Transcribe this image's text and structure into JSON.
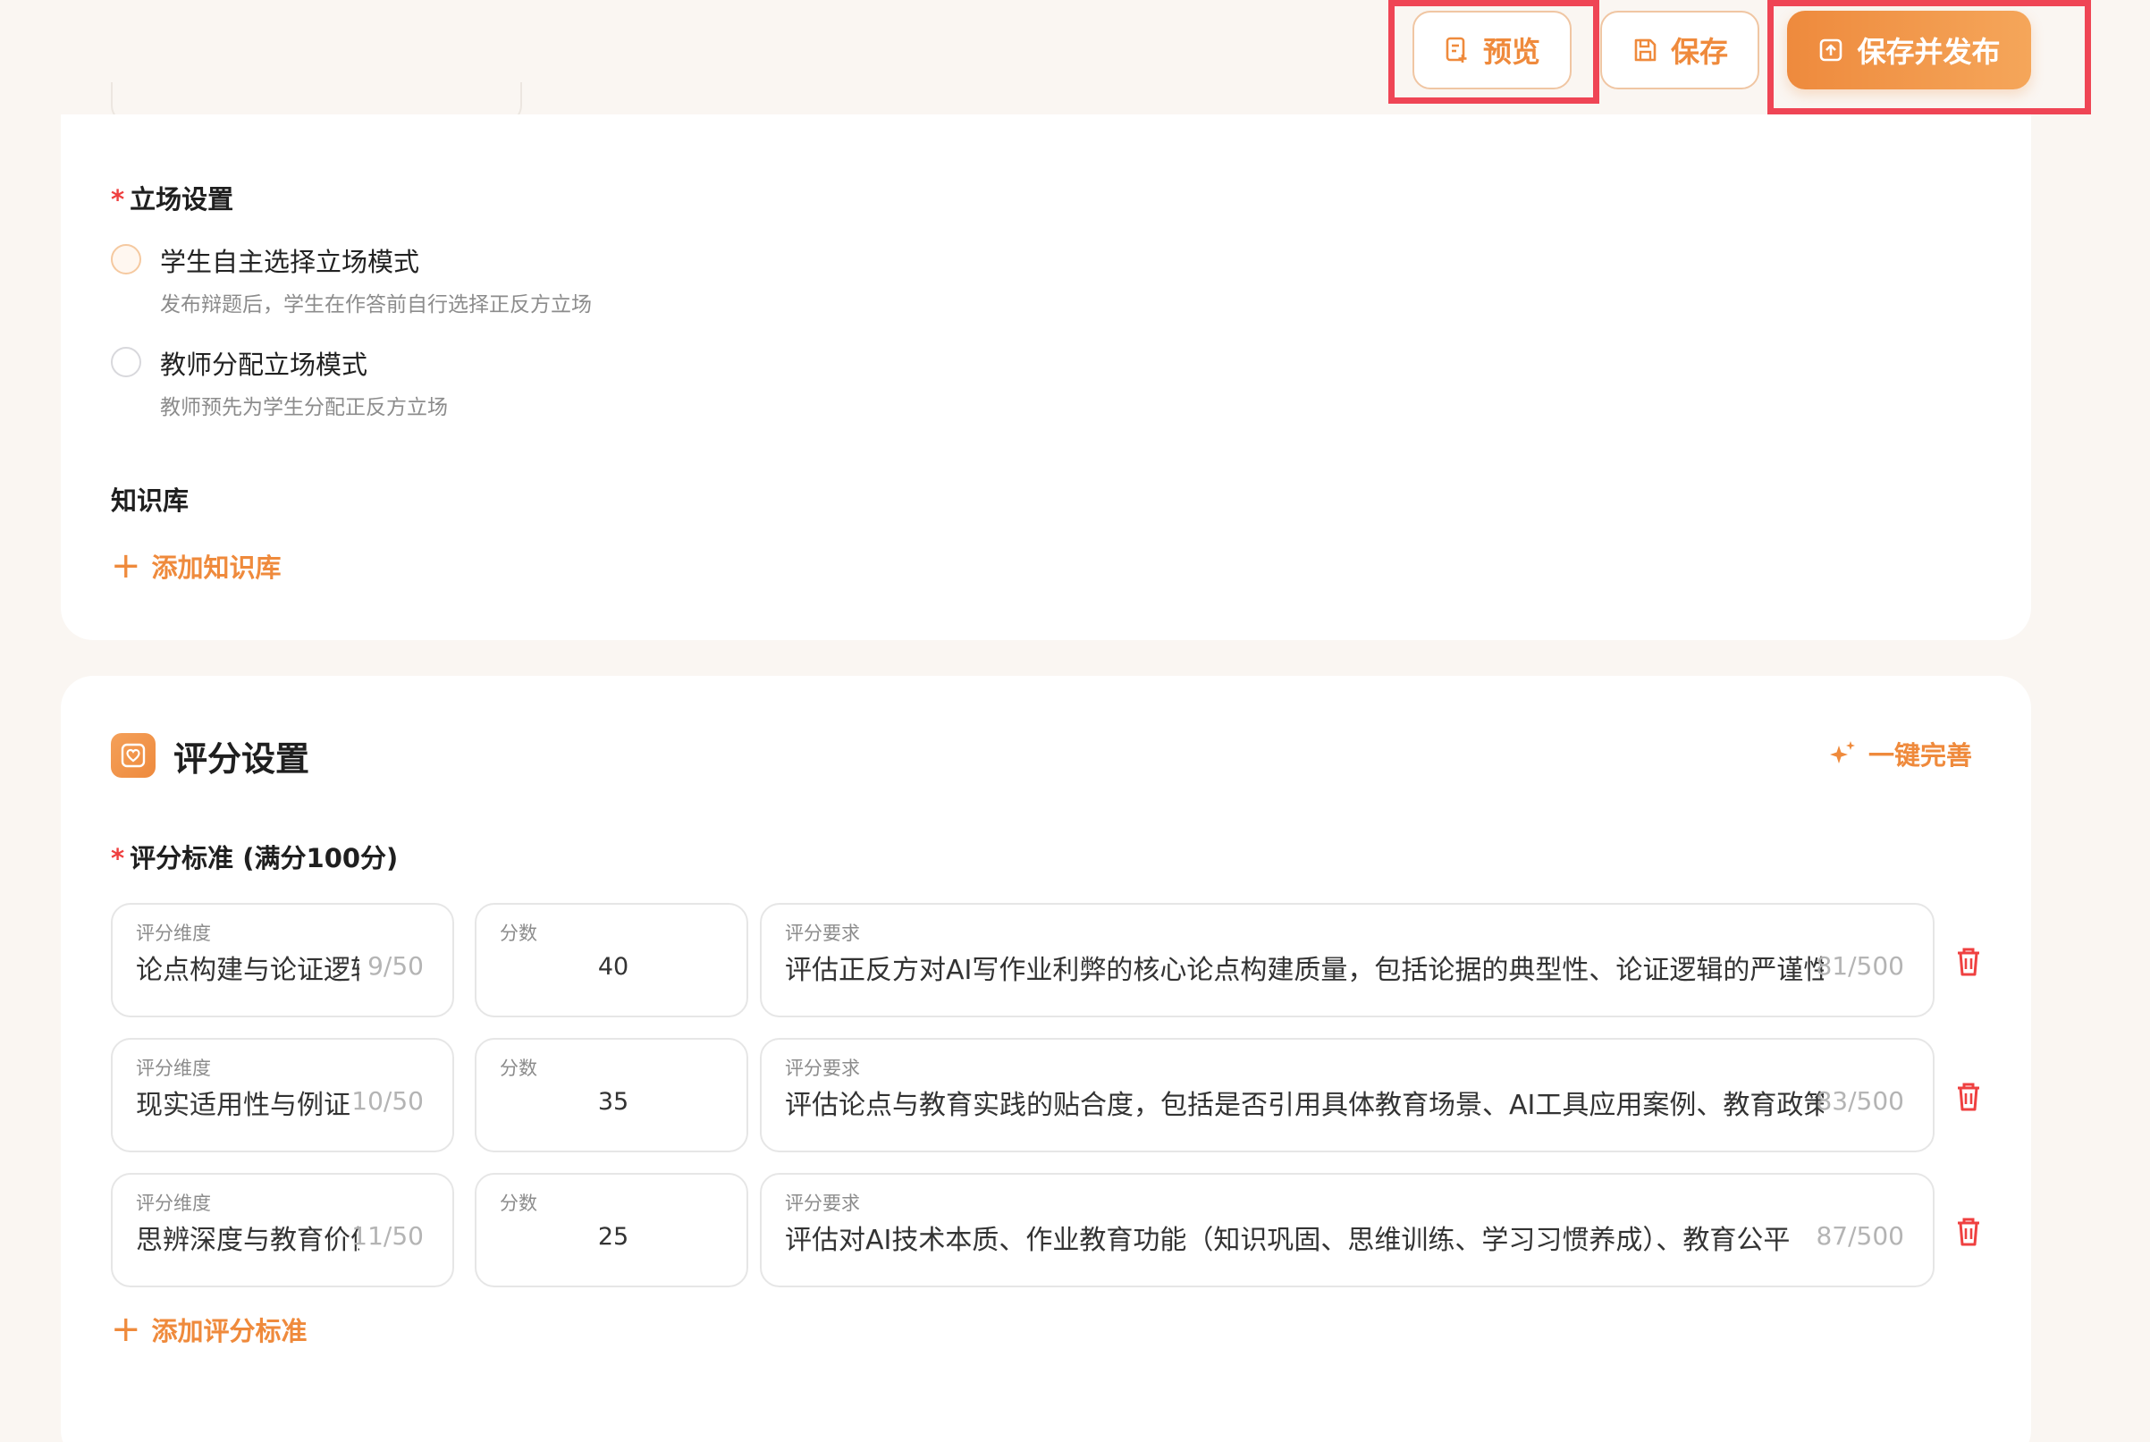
{
  "toolbar": {
    "preview_label": "预览",
    "save_label": "保存",
    "publish_label": "保存并发布"
  },
  "stance": {
    "title": "立场设置",
    "required_mark": "*",
    "options": [
      {
        "title": "学生自主选择立场模式",
        "desc": "发布辩题后，学生在作答前自行选择正反方立场"
      },
      {
        "title": "教师分配立场模式",
        "desc": "教师预先为学生分配正反方立场"
      }
    ]
  },
  "knowledge": {
    "title": "知识库",
    "add_label": "添加知识库"
  },
  "scoring": {
    "section_title": "评分设置",
    "ai_complete_label": "一键完善",
    "criteria_title": "评分标准 (满分100分)",
    "required_mark": "*",
    "dimension_label": "评分维度",
    "score_label": "分数",
    "requirement_label": "评分要求",
    "rows": [
      {
        "dimension": "论点构建与论证逻辑",
        "dimension_count": "9/50",
        "score": "40",
        "requirement": "评估正反方对AI写作业利弊的核心论点构建质量，包括论据的典型性、论证逻辑的严谨性",
        "requirement_count": "81/500"
      },
      {
        "dimension": "现实适用性与例证",
        "dimension_count": "10/50",
        "score": "35",
        "requirement": "评估论点与教育实践的贴合度，包括是否引用具体教育场景、AI工具应用案例、教育政策",
        "requirement_count": "83/500"
      },
      {
        "dimension": "思辨深度与教育价值",
        "dimension_count": "11/50",
        "score": "25",
        "requirement": "评估对AI技术本质、作业教育功能（知识巩固、思维训练、学习习惯养成）、教育公平",
        "requirement_count": "87/500"
      }
    ],
    "add_label": "添加评分标准"
  },
  "colors": {
    "accent": "#ef8a3c",
    "highlight": "#ef4555",
    "required": "#ef4040"
  }
}
